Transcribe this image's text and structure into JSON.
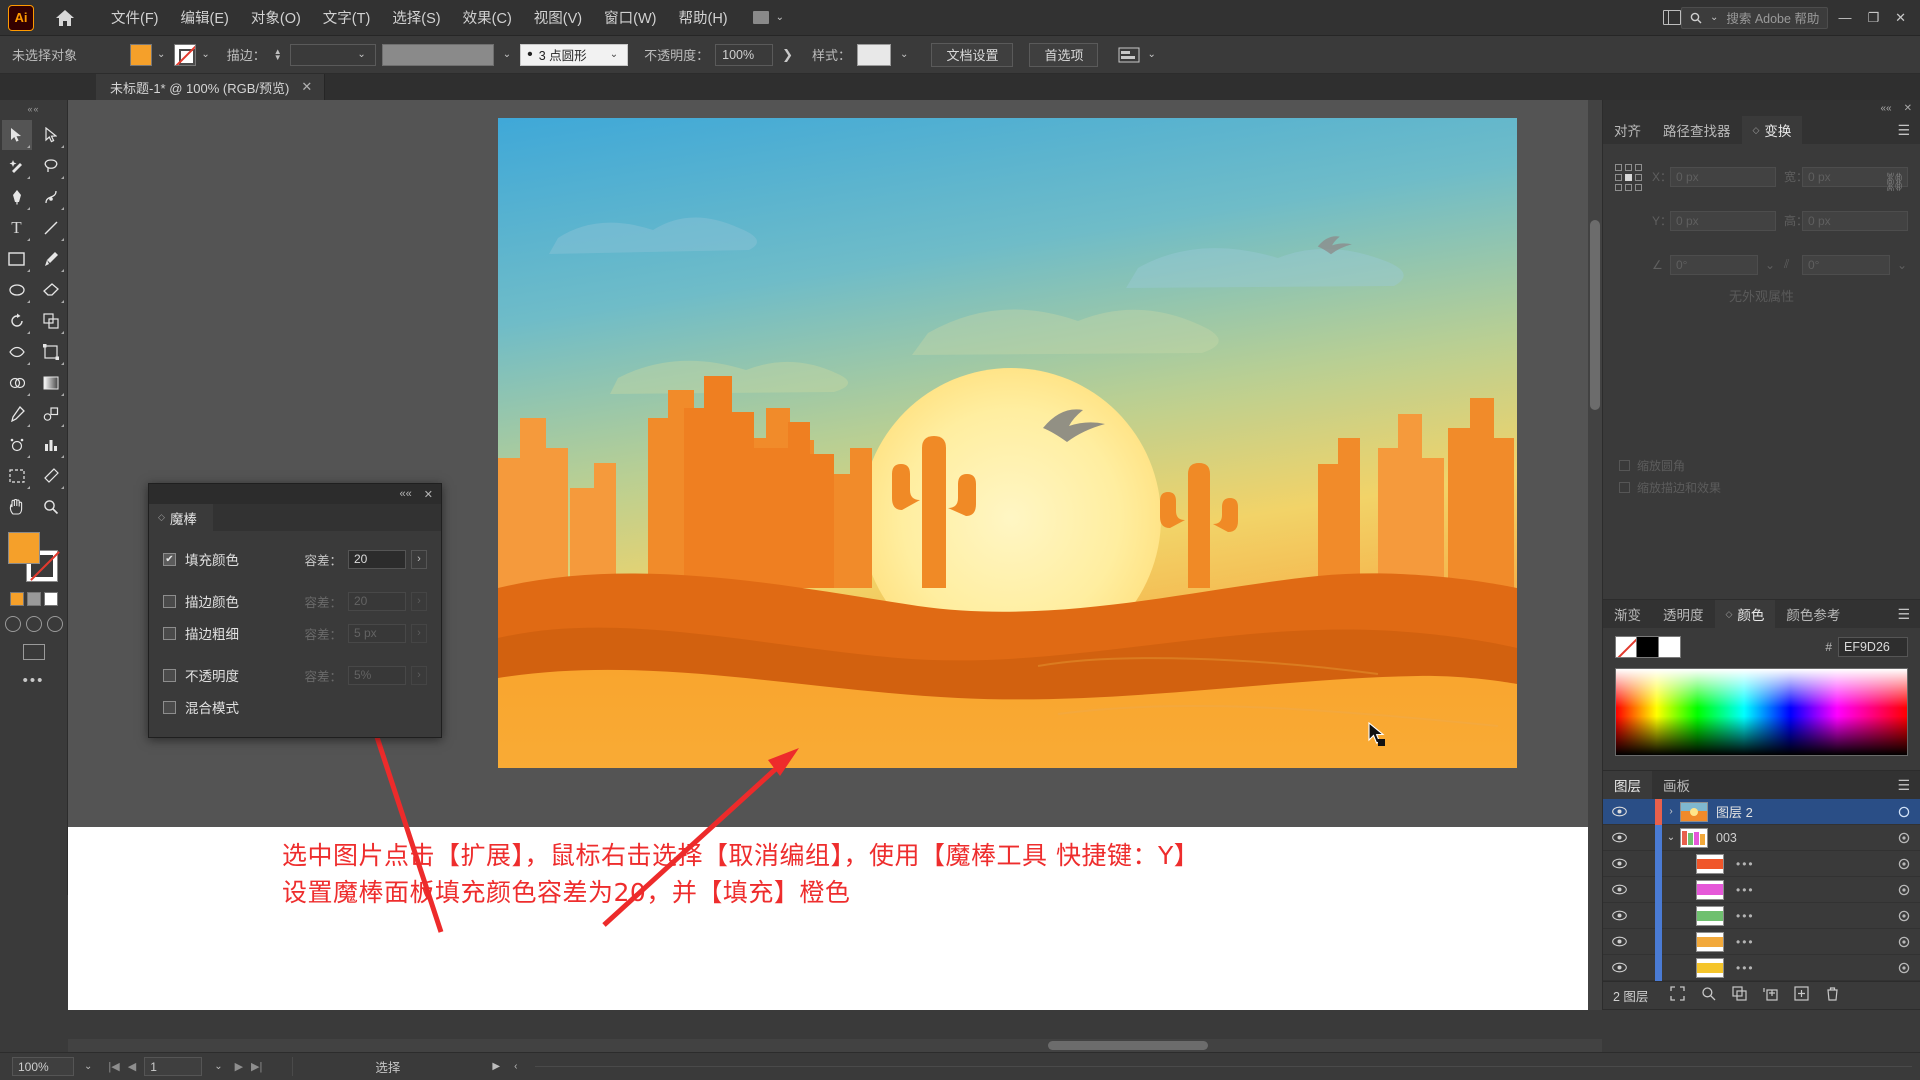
{
  "app": {
    "logo": "Ai",
    "home_icon": "home-icon"
  },
  "menubar": {
    "items": [
      {
        "label": "文件(F)"
      },
      {
        "label": "编辑(E)"
      },
      {
        "label": "对象(O)"
      },
      {
        "label": "文字(T)"
      },
      {
        "label": "选择(S)"
      },
      {
        "label": "效果(C)"
      },
      {
        "label": "视图(V)"
      },
      {
        "label": "窗口(W)"
      },
      {
        "label": "帮助(H)"
      }
    ],
    "workspace_caret": "⌄",
    "search_placeholder": "搜索 Adobe 帮助",
    "search_icon": "search-icon",
    "minimize": "—",
    "maximize": "❐",
    "close": "✕"
  },
  "controlbar": {
    "selection_status": "未选择对象",
    "fill_color": "#F5A02A",
    "stroke_label": "描边：",
    "stroke_weight": "",
    "stroke_profile": "",
    "brush_label": "3 点圆形",
    "opacity_label": "不透明度：",
    "opacity_value": "100%",
    "style_label": "样式：",
    "doc_setup_button": "文档设置",
    "preferences_button": "首选项",
    "align_icon": "align-icon",
    "caret": "⌄"
  },
  "document_tab": {
    "title": "未标题-1* @ 100% (RGB/预览)",
    "close_icon": "✕"
  },
  "toolbar": {
    "grip": "««",
    "tools": [
      {
        "name": "selection-tool",
        "glyph": "➤"
      },
      {
        "name": "direct-selection-tool",
        "glyph": "➢"
      },
      {
        "name": "magic-wand-tool",
        "glyph": "✦"
      },
      {
        "name": "lasso-tool",
        "glyph": "◠"
      },
      {
        "name": "pen-tool",
        "glyph": "✒"
      },
      {
        "name": "curvature-tool",
        "glyph": "✑"
      },
      {
        "name": "type-tool",
        "glyph": "T"
      },
      {
        "name": "line-segment-tool",
        "glyph": "╱"
      },
      {
        "name": "rectangle-tool",
        "glyph": "▭"
      },
      {
        "name": "paintbrush-tool",
        "glyph": "🖌"
      },
      {
        "name": "shaper-tool",
        "glyph": "◌"
      },
      {
        "name": "eraser-tool",
        "glyph": "◧"
      },
      {
        "name": "rotate-tool",
        "glyph": "↻"
      },
      {
        "name": "scale-tool",
        "glyph": "⤢"
      },
      {
        "name": "width-tool",
        "glyph": "◑"
      },
      {
        "name": "free-transform-tool",
        "glyph": "⬓"
      },
      {
        "name": "shape-builder-tool",
        "glyph": "◕"
      },
      {
        "name": "gradient-tool",
        "glyph": "▨"
      },
      {
        "name": "eyedropper-tool",
        "glyph": "✐"
      },
      {
        "name": "blend-tool",
        "glyph": "⬕"
      },
      {
        "name": "symbol-sprayer-tool",
        "glyph": "❂"
      },
      {
        "name": "column-graph-tool",
        "glyph": "▥"
      },
      {
        "name": "artboard-tool",
        "glyph": "⊞"
      },
      {
        "name": "slice-tool",
        "glyph": "✂"
      },
      {
        "name": "hand-tool",
        "glyph": "✋"
      },
      {
        "name": "zoom-tool",
        "glyph": "🔍"
      }
    ],
    "fill_color": "#F5A02A",
    "stroke_color": "#FFFFFF",
    "more_tools": "•••"
  },
  "canvas": {
    "artboard_name": "artboard",
    "annotation_line1": "选中图片点击【扩展】，鼠标右击选择【取消编组】，使用【魔棒工具 快捷键：Y】",
    "annotation_line2": "设置魔棒面板填充颜色容差为20，并【填充】橙色",
    "annotation_color": "#EE2D2D",
    "arrow_count": 2,
    "cursor_icon": "mouse-cursor"
  },
  "magic_wand_panel": {
    "tab_label": "魔棒",
    "collapse_icon": "««",
    "close_icon": "✕",
    "rows": [
      {
        "label": "填充颜色",
        "checked": true,
        "tol_label": "容差：",
        "tol_value": "20",
        "enabled": true
      },
      {
        "label": "描边颜色",
        "checked": false,
        "tol_label": "容差：",
        "tol_value": "20",
        "enabled": false
      },
      {
        "label": "描边粗细",
        "checked": false,
        "tol_label": "容差：",
        "tol_value": "5 px",
        "enabled": false
      },
      {
        "label": "不透明度",
        "checked": false,
        "tol_label": "容差：",
        "tol_value": "5%",
        "enabled": false
      },
      {
        "label": "混合模式",
        "checked": false,
        "tol_label": "",
        "tol_value": "",
        "enabled": false
      }
    ],
    "arrow_glyph": "›"
  },
  "right_dock": {
    "transform_panel": {
      "tabs": [
        {
          "label": "对齐",
          "active": false
        },
        {
          "label": "路径查找器",
          "active": false
        },
        {
          "label": "变换",
          "active": true
        }
      ],
      "menu_icon": "hamburger-icon",
      "fields": [
        {
          "label": "X：",
          "value": "0 px"
        },
        {
          "label": "宽：",
          "value": "0 px"
        },
        {
          "label": "Y：",
          "value": "0 px"
        },
        {
          "label": "高：",
          "value": "0 px"
        }
      ],
      "angle_value": "0°",
      "shear_value": "0°",
      "link_icon": "link-broken-icon",
      "empty_text": "无外观属性",
      "check_scale_corners": "缩放圆角",
      "check_scale_strokes": "缩放描边和效果"
    },
    "color_panel": {
      "tabs": [
        {
          "label": "渐变",
          "active": false
        },
        {
          "label": "透明度",
          "active": false
        },
        {
          "label": "颜色",
          "active": true
        },
        {
          "label": "颜色参考",
          "active": false
        }
      ],
      "menu_icon": "hamburger-icon",
      "hex_hash": "#",
      "hex_value": "EF9D26",
      "swatch_none": "none-swatch",
      "swatch_black": "#000000",
      "swatch_white": "#FFFFFF"
    },
    "layers_panel": {
      "tabs": [
        {
          "label": "图层",
          "active": true
        },
        {
          "label": "画板",
          "active": false
        }
      ],
      "menu_icon": "hamburger-icon",
      "rows": [
        {
          "name": "图层 2",
          "selected": true,
          "indent": 0,
          "bar": "#E8604C",
          "twisty": "›",
          "thumb": "sunset",
          "dots": "",
          "eye": true
        },
        {
          "name": "003",
          "selected": false,
          "indent": 1,
          "bar": "#4A7BD4",
          "twisty": "⌄",
          "thumb": "multi",
          "dots": "",
          "eye": true
        },
        {
          "name": "",
          "selected": false,
          "indent": 2,
          "bar": "#4A7BD4",
          "twisty": "",
          "thumb": "#F0562A",
          "dots": "•••",
          "eye": true
        },
        {
          "name": "",
          "selected": false,
          "indent": 2,
          "bar": "#4A7BD4",
          "twisty": "",
          "thumb": "#E558D8",
          "dots": "•••",
          "eye": true
        },
        {
          "name": "",
          "selected": false,
          "indent": 2,
          "bar": "#4A7BD4",
          "twisty": "",
          "thumb": "#6FC06F",
          "dots": "•••",
          "eye": true
        },
        {
          "name": "",
          "selected": false,
          "indent": 2,
          "bar": "#4A7BD4",
          "twisty": "",
          "thumb": "#F2A93B",
          "dots": "•••",
          "eye": true
        },
        {
          "name": "",
          "selected": false,
          "indent": 2,
          "bar": "#4A7BD4",
          "twisty": "",
          "thumb": "#F5C52B",
          "dots": "•••",
          "eye": true
        }
      ],
      "footer_count": "2 图层",
      "footer_icons": [
        "locate-icon",
        "search-icon",
        "duplicate-icon",
        "new-sublayer-icon",
        "new-layer-icon",
        "delete-icon"
      ]
    }
  },
  "statusbar": {
    "zoom_value": "100%",
    "zoom_caret": "⌄",
    "first_icon": "|◀",
    "prev_icon": "◀",
    "page_value": "1",
    "page_caret": "⌄",
    "next_icon": "▶",
    "last_icon": "▶|",
    "status_text": "选择",
    "expand_icon": "▶",
    "collapse_icon": "‹"
  }
}
